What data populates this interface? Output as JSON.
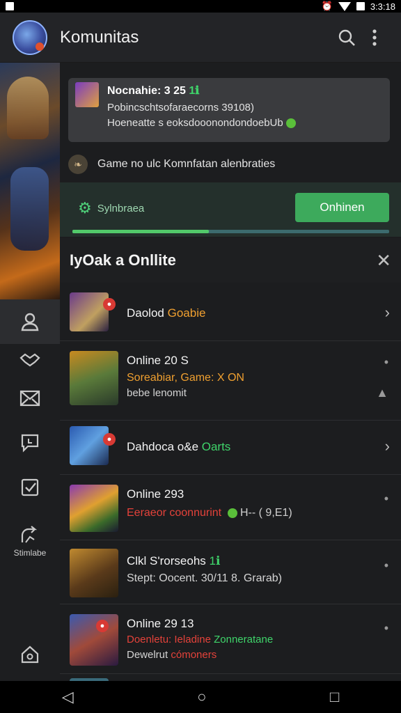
{
  "status": {
    "time": "3:3:18"
  },
  "appbar": {
    "title": "Komunitas"
  },
  "sidebar": {
    "label": "Stimlabe"
  },
  "notice": {
    "title": "Nocnahie: 3 25",
    "title_tag": "1ℹ",
    "line2": "Pobincschtsofaraecorns 39108)",
    "line3": "Hoeneatte s eoksdooonondondoebUb"
  },
  "info": {
    "text": "Game no ulc Komnfatan alenbraties"
  },
  "sync": {
    "label": "Sylnbraea",
    "button": "Onhinen",
    "progress": 0.43
  },
  "section": {
    "title": "IyOak a Onllite"
  },
  "list": [
    {
      "l1a": "Daolod ",
      "l1b": "Goabie"
    },
    {
      "l1": "Online 20 S",
      "l2": "Soreabiar, Game: X ON",
      "l3": "bebe lenomit"
    },
    {
      "l1a": "Dahdoca o&e ",
      "l1b": "Oarts"
    },
    {
      "l1": "Online 293",
      "l2a": "Eeraeor coonnurint",
      "l2b": "H-- ( 9,E1)"
    },
    {
      "l1a": "Clkl S'rorseohs ",
      "l1b": "1ℹ",
      "l2": "Stept: Oocent. 30/11 8. Grarab)"
    },
    {
      "l1": "Online 29 13",
      "l2a": "Doenletu: Ieladine ",
      "l2b": "Zonneratane",
      "l3a": "Dewelrut ",
      "l3b": "cómoners"
    }
  ]
}
